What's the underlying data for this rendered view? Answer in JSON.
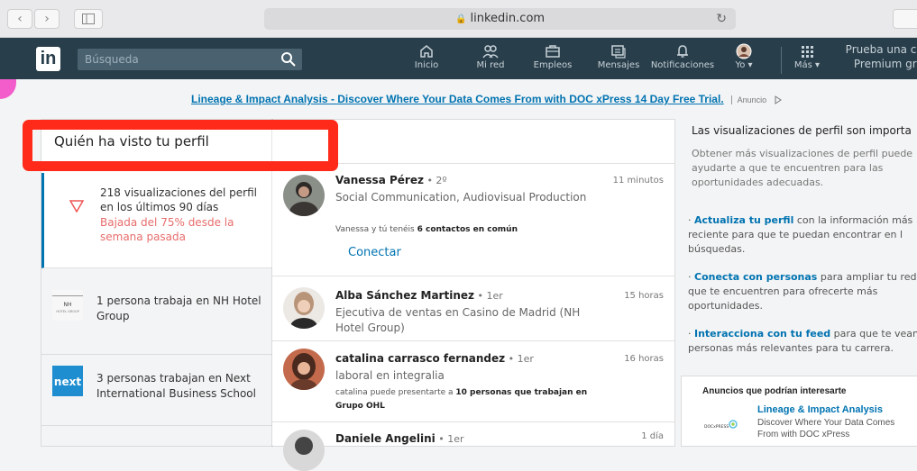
{
  "browser": {
    "url": "linkedin.com",
    "back_icon": "chevron-left-icon",
    "forward_icon": "chevron-right-icon"
  },
  "nav": {
    "logo": "in",
    "search_placeholder": "Búsqueda",
    "items": [
      {
        "label": "Inicio",
        "icon": "home-icon"
      },
      {
        "label": "Mi red",
        "icon": "network-icon"
      },
      {
        "label": "Empleos",
        "icon": "briefcase-icon"
      },
      {
        "label": "Mensajes",
        "icon": "messages-icon"
      },
      {
        "label": "Notificaciones",
        "icon": "bell-icon"
      },
      {
        "label": "Yo ▾",
        "icon": "avatar"
      },
      {
        "label": "Más ▾",
        "icon": "grid-icon"
      }
    ],
    "premium_line1": "Prueba una cu",
    "premium_line2": "Premium gra"
  },
  "ad_banner": {
    "link": "Lineage & Impact Analysis - Discover Where Your Data Comes From with DOC xPress 14 Day Free Trial.",
    "label": "Anuncio"
  },
  "left": {
    "title": "Quién ha visto tu perfil",
    "views": "218 visualizaciones del perfil en los últimos 90 días",
    "drop": "Bajada del 75% desde la semana pasada",
    "companies": [
      {
        "text": "1 persona trabaja en NH Hotel Group",
        "logo": "NH",
        "logo_sub": "HOTEL GROUP"
      },
      {
        "text": "3 personas trabajan en Next International Business School",
        "logo": "next"
      }
    ]
  },
  "viewers": [
    {
      "name": "Vanessa Pérez",
      "degree": " • 2º",
      "title": "Social Communication, Audiovisual Production",
      "time": "11 minutos",
      "common_prefix": "Vanessa y tú tenéis ",
      "common_bold": "6 contactos en común",
      "connect": "Conectar"
    },
    {
      "name": "Alba Sánchez Martinez",
      "degree": " • 1er",
      "title": "Ejecutiva de ventas en Casino de Madrid (NH Hotel Group)",
      "time": "15 horas"
    },
    {
      "name": "catalina carrasco fernandez",
      "degree": " • 1er",
      "title": "laboral en integralia",
      "time": "16 horas",
      "common_prefix": "catalina puede presentarte a ",
      "common_bold": "10 personas que trabajan en Grupo OHL"
    },
    {
      "name": "Daniele Angelini",
      "degree": " • 1er",
      "time": "1 día"
    }
  ],
  "right": {
    "title": "Las visualizaciones de perfil son importa",
    "intro": "Obtener más visualizaciones de perfil puede ayudarte a que te encuentren para las oportunidades adecuadas.",
    "tips": [
      {
        "link": "Actualiza tu perfil",
        "text": " con la información más reciente para que te puedan encontrar en l búsquedas."
      },
      {
        "link": "Conecta con personas",
        "text": " para ampliar tu red que te encuentren para ofrecerte más oportunidades."
      },
      {
        "link": "Interacciona con tu feed",
        "text": " para que te vean personas más relevantes para tu carrera."
      }
    ],
    "ads_heading": "Anuncios que podrían interesarte",
    "ad_title": "Lineage & Impact Analysis",
    "ad_desc": "Discover Where Your Data Comes From with DOC xPress",
    "ad_logo_text": "DOCxPRESS"
  },
  "colors": {
    "nav_bg": "#283e4a",
    "link_blue": "#0073b1",
    "highlight_red": "#ff2a1a",
    "drop_red": "#e86c6c"
  }
}
